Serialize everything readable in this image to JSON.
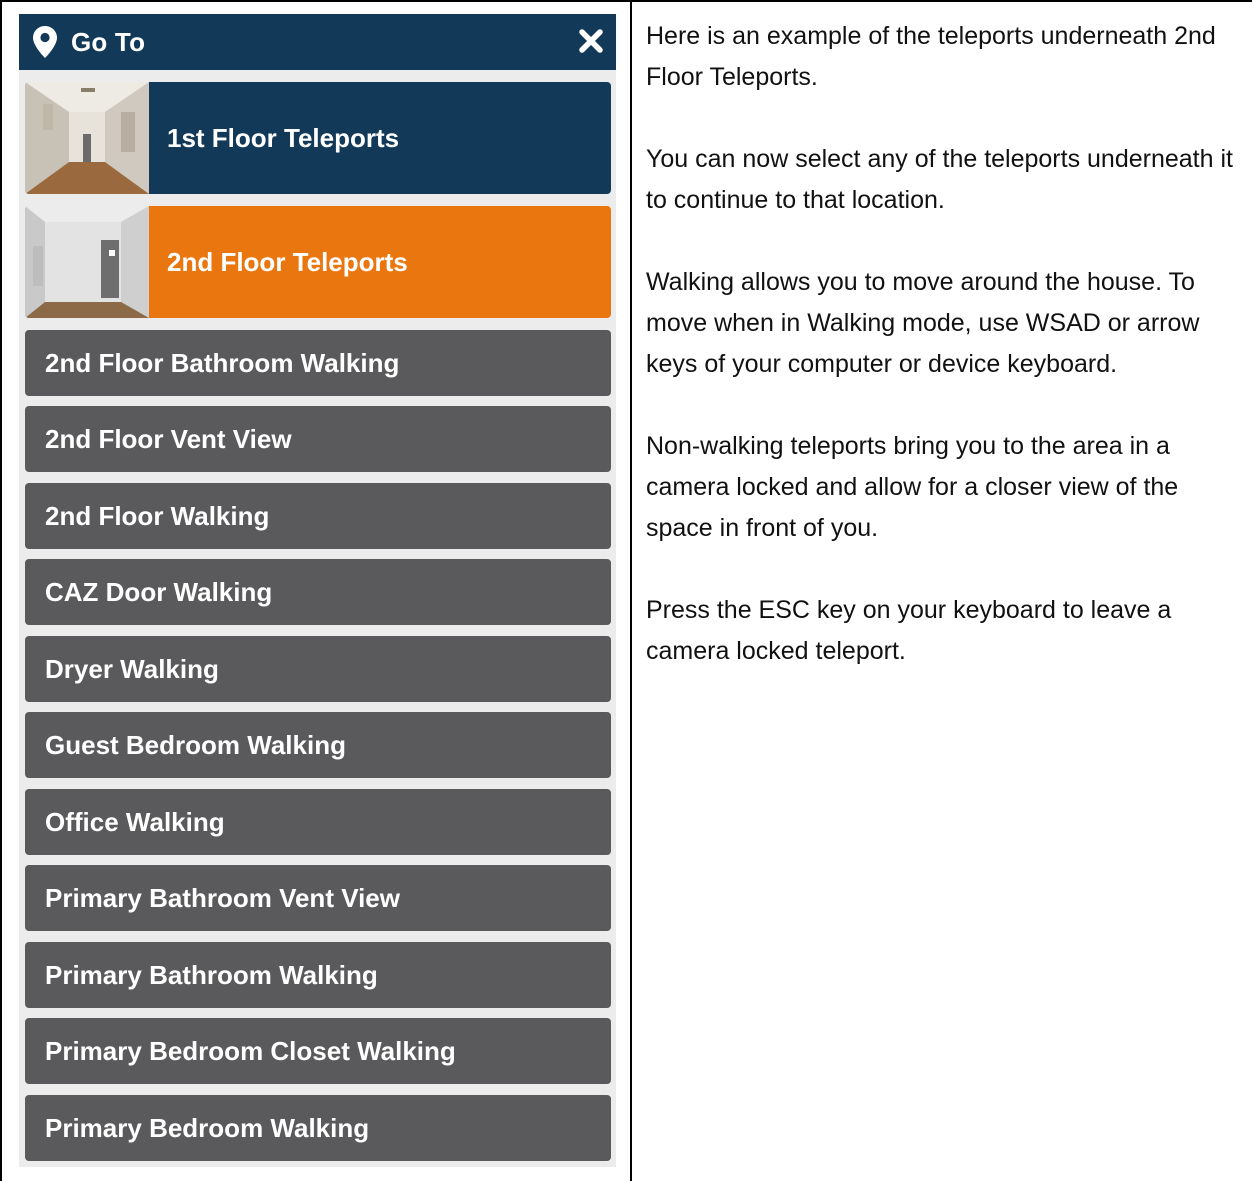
{
  "panel": {
    "title": "Go To",
    "pin_icon": "map-pin-icon",
    "close_icon": "close-icon",
    "colors": {
      "header": "#123958",
      "selected": "#ea760f",
      "item": "#5a5a5c"
    },
    "floors": [
      {
        "label": "1st Floor Teleports",
        "state": "default"
      },
      {
        "label": "2nd Floor Teleports",
        "state": "selected"
      }
    ],
    "items": [
      "2nd Floor Bathroom Walking",
      "2nd Floor Vent View",
      "2nd Floor Walking",
      "CAZ Door Walking",
      "Dryer Walking",
      "Guest Bedroom Walking",
      "Office Walking",
      "Primary Bathroom Vent View",
      "Primary Bathroom Walking",
      "Primary Bedroom Closet Walking",
      "Primary Bedroom Walking"
    ]
  },
  "explanation": {
    "paragraphs": [
      "Here is an example of the teleports underneath 2nd Floor Teleports.",
      "You can now select any of the teleports underneath it to continue to that location.",
      "Walking allows you to move around the house. To move when in Walking mode, use WSAD or arrow keys of your computer or device keyboard.",
      "Non-walking teleports bring you to the area in a camera locked and allow for a closer view of the space in front of you.",
      "Press the ESC key on your keyboard to leave a camera locked teleport."
    ]
  }
}
